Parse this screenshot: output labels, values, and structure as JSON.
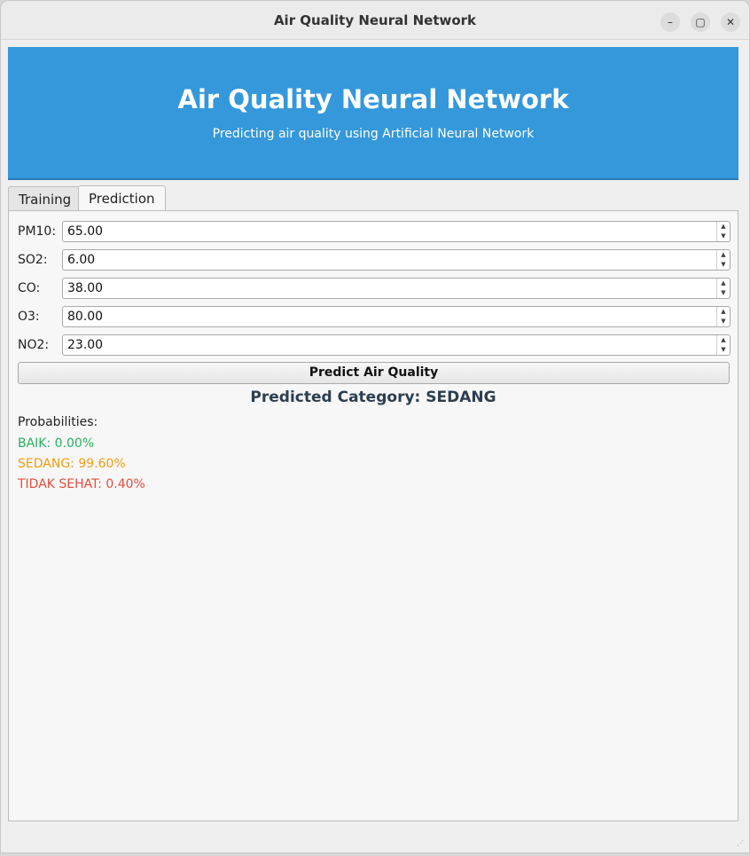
{
  "window": {
    "title": "Air Quality Neural Network",
    "controls": {
      "minimize": "–",
      "maximize": "▢",
      "close": "✕"
    }
  },
  "header": {
    "title": "Air Quality Neural Network",
    "subtitle": "Predicting air quality using Artificial Neural Network",
    "background": "#3498db"
  },
  "tabs": [
    {
      "label": "Training",
      "active": false
    },
    {
      "label": "Prediction",
      "active": true
    }
  ],
  "inputs": [
    {
      "label": "PM10:",
      "value": "65.00"
    },
    {
      "label": "SO2:",
      "value": "6.00"
    },
    {
      "label": "CO:",
      "value": "38.00"
    },
    {
      "label": "O3:",
      "value": "80.00"
    },
    {
      "label": "NO2:",
      "value": "23.00"
    }
  ],
  "predict_button": "Predict Air Quality",
  "result": "Predicted Category: SEDANG",
  "probabilities": {
    "title": "Probabilities:",
    "items": [
      {
        "text": "BAIK: 0.00%",
        "color": "#27ae60"
      },
      {
        "text": "SEDANG: 99.60%",
        "color": "#f39c12"
      },
      {
        "text": "TIDAK SEHAT: 0.40%",
        "color": "#e74c3c"
      }
    ]
  }
}
